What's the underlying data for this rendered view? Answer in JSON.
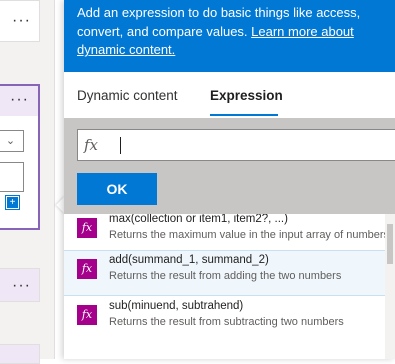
{
  "banner": {
    "text": "Add an expression to do basic things like access, convert, and compare values. ",
    "link": "Learn more about dynamic content."
  },
  "tabs": [
    {
      "label": "Dynamic content"
    },
    {
      "label": "Expression"
    }
  ],
  "expression": {
    "icon": "fx",
    "value": ""
  },
  "ok_label": "OK",
  "functions": [
    {
      "icon": "fx",
      "name": "max(collection or item1, item2?, ...)",
      "description": "Returns the maximum value in the input array of numbers"
    },
    {
      "icon": "fx",
      "name": "add(summand_1, summand_2)",
      "description": "Returns the result from adding the two numbers"
    },
    {
      "icon": "fx",
      "name": "sub(minuend, subtrahend)",
      "description": "Returns the result from subtracting two numbers"
    }
  ],
  "left": {
    "ellipsis": "···",
    "plus": "+"
  },
  "colors": {
    "accent": "#0078d4",
    "function_icon": "#a4008c"
  }
}
